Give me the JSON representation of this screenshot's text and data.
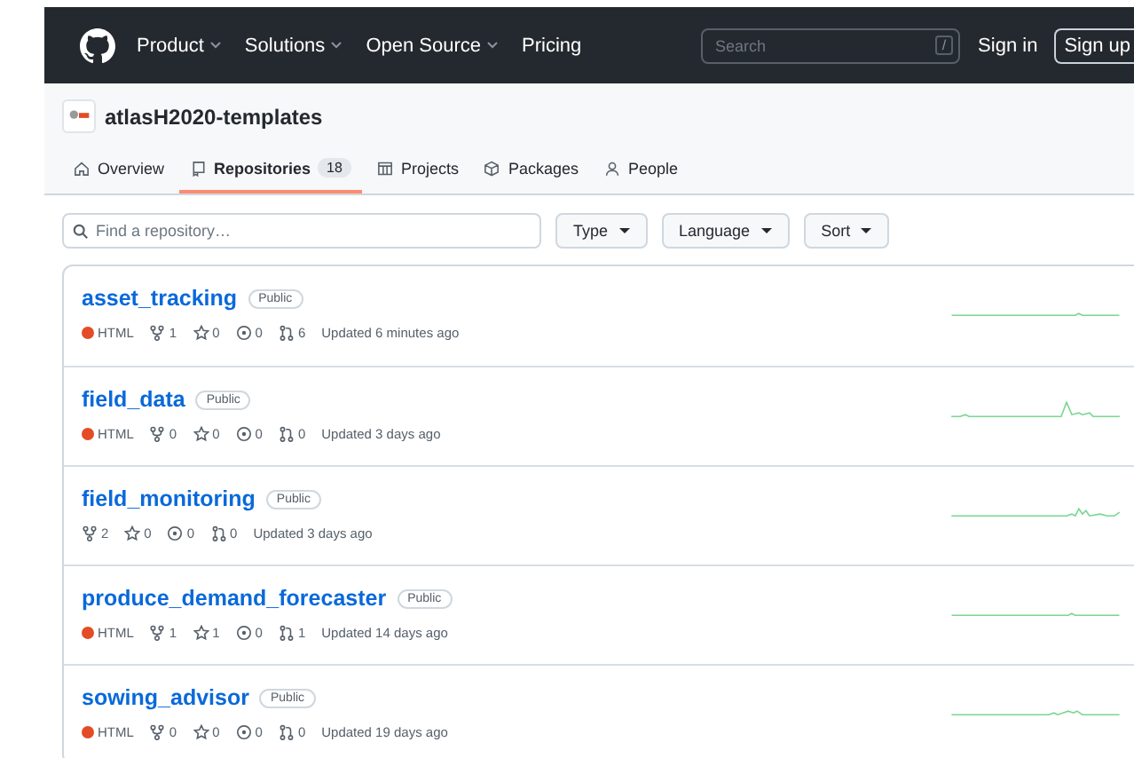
{
  "header": {
    "nav": [
      {
        "label": "Product",
        "dropdown": true
      },
      {
        "label": "Solutions",
        "dropdown": true
      },
      {
        "label": "Open Source",
        "dropdown": true
      },
      {
        "label": "Pricing",
        "dropdown": false
      }
    ],
    "search": {
      "placeholder": "Search",
      "shortcut": "/"
    },
    "sign_in": "Sign in",
    "sign_up": "Sign up"
  },
  "org": {
    "name": "atlasH2020-templates",
    "tabs": [
      {
        "label": "Overview",
        "selected": false
      },
      {
        "label": "Repositories",
        "count": "18",
        "selected": true
      },
      {
        "label": "Projects",
        "selected": false
      },
      {
        "label": "Packages",
        "selected": false
      },
      {
        "label": "People",
        "selected": false
      }
    ]
  },
  "filter": {
    "placeholder": "Find a repository…",
    "buttons": [
      "Type",
      "Language",
      "Sort"
    ]
  },
  "repos": [
    {
      "name": "asset_tracking",
      "visibility": "Public",
      "language": {
        "name": "HTML",
        "color": "#e34c26"
      },
      "forks": "1",
      "stars": "0",
      "issues": "0",
      "pulls": "6",
      "updated": "Updated 6 minutes ago"
    },
    {
      "name": "field_data",
      "visibility": "Public",
      "language": {
        "name": "HTML",
        "color": "#e34c26"
      },
      "forks": "0",
      "stars": "0",
      "issues": "0",
      "pulls": "0",
      "updated": "Updated 3 days ago"
    },
    {
      "name": "field_monitoring",
      "visibility": "Public",
      "forks": "2",
      "stars": "0",
      "issues": "0",
      "pulls": "0",
      "updated": "Updated 3 days ago"
    },
    {
      "name": "produce_demand_forecaster",
      "visibility": "Public",
      "language": {
        "name": "HTML",
        "color": "#e34c26"
      },
      "forks": "1",
      "stars": "1",
      "issues": "0",
      "pulls": "1",
      "updated": "Updated 14 days ago"
    },
    {
      "name": "sowing_advisor",
      "visibility": "Public",
      "language": {
        "name": "HTML",
        "color": "#e34c26"
      },
      "forks": "0",
      "stars": "0",
      "issues": "0",
      "pulls": "0",
      "updated": "Updated 19 days ago"
    }
  ]
}
